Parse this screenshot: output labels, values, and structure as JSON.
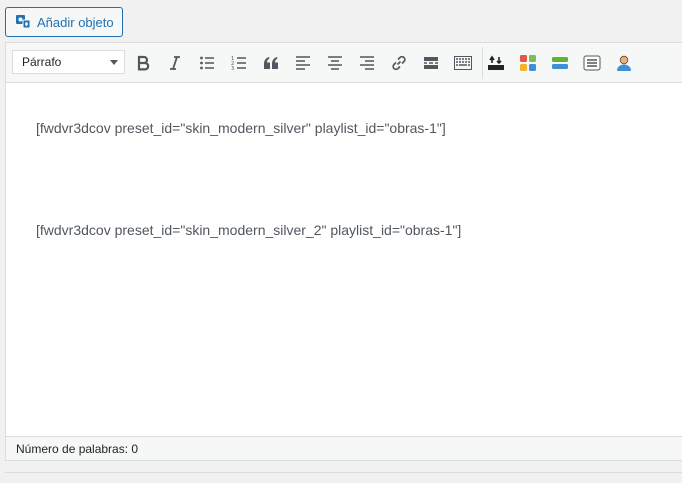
{
  "media_button": {
    "label": "Añadir objeto",
    "icon": "add-media-icon"
  },
  "toolbar": {
    "format_select": {
      "selected": "Párrafo",
      "icon": "chevron-down-icon"
    },
    "buttons": [
      {
        "name": "bold",
        "icon": "bold-icon"
      },
      {
        "name": "italic",
        "icon": "italic-icon"
      },
      {
        "name": "bulleted-list",
        "icon": "bulleted-list-icon"
      },
      {
        "name": "numbered-list",
        "icon": "numbered-list-icon"
      },
      {
        "name": "blockquote",
        "icon": "quote-icon"
      },
      {
        "name": "align-left",
        "icon": "align-left-icon"
      },
      {
        "name": "align-center",
        "icon": "align-center-icon"
      },
      {
        "name": "align-right",
        "icon": "align-right-icon"
      },
      {
        "name": "insert-link",
        "icon": "link-icon"
      },
      {
        "name": "read-more",
        "icon": "read-more-icon"
      },
      {
        "name": "toolbar-toggle",
        "icon": "keyboard-icon"
      },
      {
        "name": "plugin-upload",
        "icon": "upload-icon"
      },
      {
        "name": "plugin-grid",
        "icon": "colored-grid-icon"
      },
      {
        "name": "plugin-bars",
        "icon": "green-bars-icon"
      },
      {
        "name": "plugin-list",
        "icon": "list-box-icon"
      },
      {
        "name": "plugin-user",
        "icon": "user-icon"
      }
    ]
  },
  "content": {
    "lines": [
      "[fwdvr3dcov preset_id=\"skin_modern_silver\" playlist_id=\"obras-1\"]",
      "[fwdvr3dcov preset_id=\"skin_modern_silver_2\" playlist_id=\"obras-1\"]"
    ]
  },
  "status_bar": {
    "word_count": "Número de palabras: 0"
  },
  "colors": {
    "accent": "#2271b1",
    "toolbar_bg": "#f6f7f7",
    "border": "#dcdcde",
    "text": "#50575e"
  }
}
